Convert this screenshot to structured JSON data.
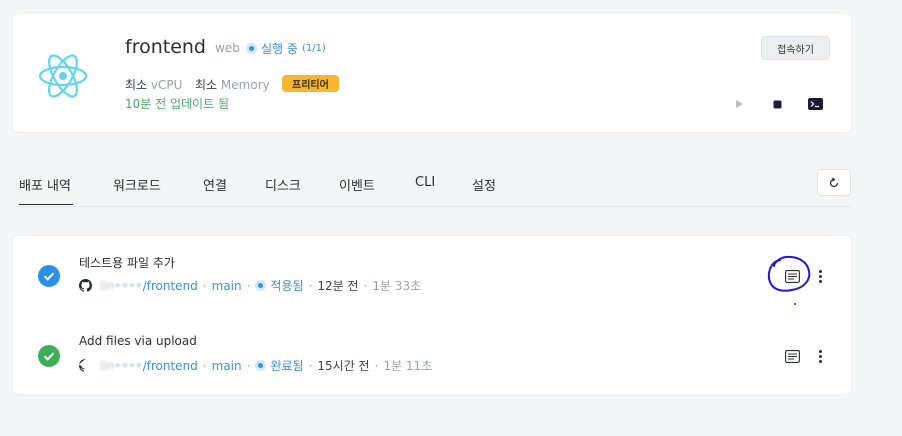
{
  "service": {
    "name": "frontend",
    "type": "web",
    "status": "실행 중",
    "status_count": "(1/1)",
    "cpu_label": "최소",
    "cpu_unit": "vCPU",
    "memory_label": "최소",
    "memory_unit": "Memory",
    "tier_badge": "프리티어",
    "updated": "10분 전 업데이트 됨",
    "connect_button": "접속하기",
    "logo_icon": "react-icon",
    "controls": [
      "play-icon",
      "stop-icon",
      "terminal-icon"
    ]
  },
  "tabs": [
    {
      "label": "배포 내역",
      "active": true
    },
    {
      "label": "워크로드"
    },
    {
      "label": "연결"
    },
    {
      "label": "디스크"
    },
    {
      "label": "이벤트"
    },
    {
      "label": "CLI"
    },
    {
      "label": "설정"
    }
  ],
  "deployments": [
    {
      "title": "테스트용 파일 추가",
      "repo_owner": "lin••••",
      "repo_name": "/frontend",
      "branch": "main",
      "state": "적용됨",
      "time_ago": "12분 전",
      "duration": "1분 33초",
      "check_color": "#2d8fe6"
    },
    {
      "title": "Add files via upload",
      "repo_owner": "lin••••",
      "repo_name": "/frontend",
      "branch": "main",
      "state": "완료됨",
      "time_ago": "15시간 전",
      "duration": "1분 11초",
      "check_color": "#3cae5c"
    }
  ],
  "colors": {
    "accent": "#3a8fe0",
    "success": "#4aa867",
    "badge": "#f7b62d",
    "annotation": "#1a1ad8"
  }
}
